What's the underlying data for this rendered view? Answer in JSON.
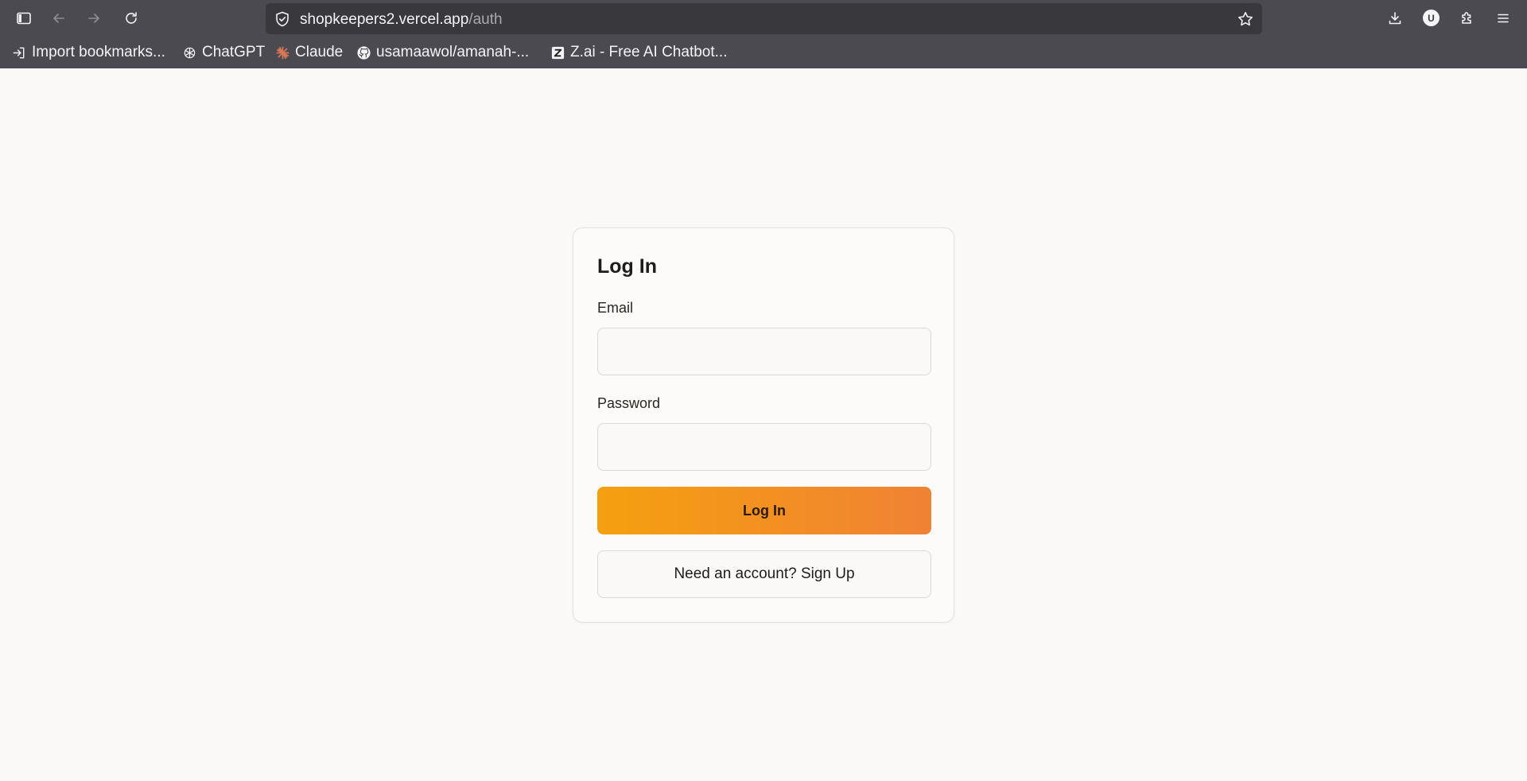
{
  "browser": {
    "url_host": "shopkeepers2.vercel.app",
    "url_path": "/auth",
    "account_initial": "U",
    "icons": {
      "sidebar": "sidebar-icon",
      "back": "arrow-left-icon",
      "forward": "arrow-right-icon",
      "reload": "reload-icon",
      "site_info": "shield-icon",
      "bookmark": "star-icon",
      "downloads": "download-icon",
      "extensions": "puzzle-icon",
      "menu": "hamburger-menu-icon"
    },
    "bookmarks": [
      {
        "label": "Import bookmarks...",
        "icon": "import-icon"
      },
      {
        "label": "ChatGPT",
        "icon": "openai-icon"
      },
      {
        "label": "Claude",
        "icon": "claude-icon"
      },
      {
        "label": "usamaawol/amanah-...",
        "icon": "github-icon"
      },
      {
        "label": "Z.ai - Free AI Chatbot...",
        "icon": "zai-icon"
      }
    ]
  },
  "login": {
    "title": "Log In",
    "email_label": "Email",
    "email_value": "",
    "password_label": "Password",
    "password_value": "",
    "submit_label": "Log In",
    "signup_label": "Need an account? Sign Up"
  },
  "colors": {
    "page_bg": "#faf9f7",
    "chrome_bg": "#4a4a50",
    "urlbar_bg": "#38383d",
    "accent_start": "#f5a00f",
    "accent_end": "#f08234"
  }
}
